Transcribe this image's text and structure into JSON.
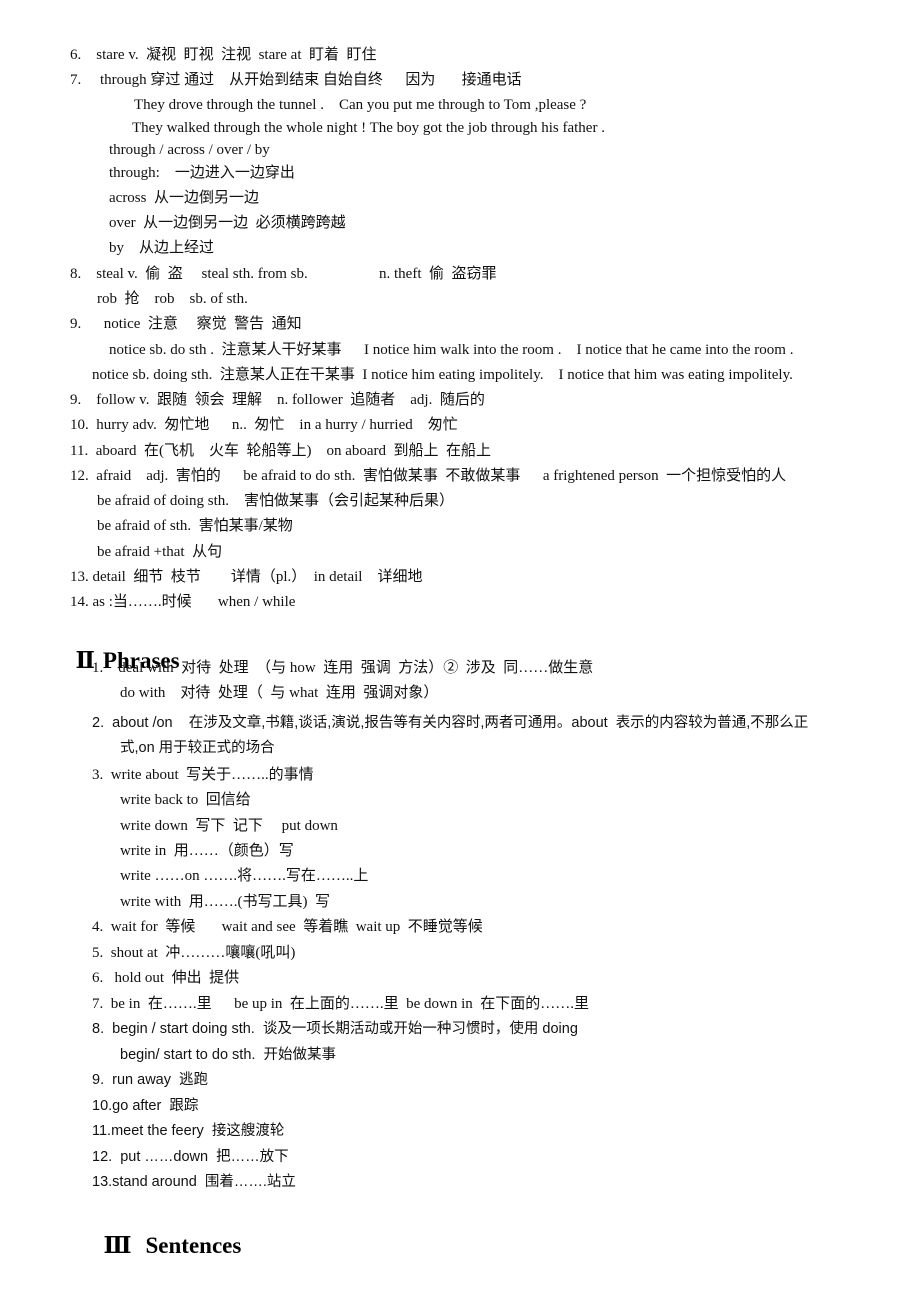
{
  "vocab": [
    {
      "id": "l1",
      "text": "6.    stare v.  凝视  盯视  注视  stare at  盯着  盯住"
    },
    {
      "id": "l2",
      "text": "7.     through 穿过 通过    从开始到结束 自始自终      因为       接通电话"
    },
    {
      "id": "l3",
      "text": "They drove through the tunnel .    Can you put me through to Tom ,please ?"
    },
    {
      "id": "l4",
      "text": "They walked through the whole night ! The boy got the job through his father ."
    },
    {
      "id": "l5",
      "text": "through / across / over / by"
    },
    {
      "id": "l6",
      "text": "through:    一边进入一边穿出"
    },
    {
      "id": "l7",
      "text": "across  从一边倒另一边"
    },
    {
      "id": "l8",
      "text": "over  从一边倒另一边  必须横跨跨越"
    },
    {
      "id": "l9",
      "text": "by    从边上经过"
    },
    {
      "id": "l10",
      "text": "8.    steal v.  偷  盗     steal sth. from sb.                   n. theft  偷  盗窃罪"
    },
    {
      "id": "l11",
      "text": "rob  抢    rob    sb. of sth."
    },
    {
      "id": "l12",
      "text": "9.      notice  注意     察觉  警告  通知"
    },
    {
      "id": "l13",
      "text": "notice sb. do sth .  注意某人干好某事      I notice him walk into the room .    I notice that he came into the room ."
    },
    {
      "id": "l14",
      "text": "notice sb. doing sth.  注意某人正在干某事  I notice him eating impolitely.    I notice that him was eating impolitely."
    },
    {
      "id": "l15",
      "text": "9.    follow v.  跟随  领会  理解    n. follower  追随者    adj.  随后的"
    },
    {
      "id": "l16",
      "text": "10.  hurry adv.  匆忙地      n..  匆忙    in a hurry / hurried    匆忙"
    },
    {
      "id": "l17",
      "text": "11.  aboard  在(飞机    火车  轮船等上)    on aboard  到船上  在船上"
    },
    {
      "id": "l18",
      "text": "12.  afraid    adj.  害怕的      be afraid to do sth.  害怕做某事  不敢做某事      a frightened person  一个担惊受怕的人"
    },
    {
      "id": "l19",
      "text": "be afraid of doing sth.    害怕做某事（会引起某种后果）"
    },
    {
      "id": "l20",
      "text": "be afraid of sth.  害怕某事/某物"
    },
    {
      "id": "l21",
      "text": "be afraid +that  从句"
    },
    {
      "id": "l22",
      "text": "13. detail  细节  枝节        详情（pl.）  in detail    详细地"
    },
    {
      "id": "l23",
      "text": "14. as :当…….时候       when / while"
    }
  ],
  "section2": {
    "numeral": "Ⅱ",
    "title": "Phrases"
  },
  "phrases": [
    {
      "id": "p1",
      "text": "1.    deal with  对待  处理  （与 how  连用  强调  方法）②  涉及  同……做生意"
    },
    {
      "id": "p2",
      "text": "do with    对待  处理（  与 what  连用  强调对象）"
    },
    {
      "id": "p3",
      "text": "2.  about /on    在涉及文章,书籍,谈话,演说,报告等有关内容时,两者可通用。about  表示的内容较为普通,不那么正"
    },
    {
      "id": "p4",
      "text": "式,on 用于较正式的场合"
    },
    {
      "id": "p5",
      "text": "3.  write about  写关于……..的事情"
    },
    {
      "id": "p6",
      "text": "write back to  回信给"
    },
    {
      "id": "p7",
      "text": "write down  写下  记下     put down"
    },
    {
      "id": "p8",
      "text": "write in  用……（颜色）写"
    },
    {
      "id": "p9",
      "text": "write ……on …….将…….写在……..上"
    },
    {
      "id": "p10",
      "text": "write with  用…….(书写工具)  写"
    },
    {
      "id": "p11",
      "text": "4.  wait for  等候       wait and see  等着瞧  wait up  不睡觉等候"
    },
    {
      "id": "p12",
      "text": "5.  shout at  冲………嚷嚷(吼叫)"
    },
    {
      "id": "p13",
      "text": "6.   hold out  伸出  提供"
    },
    {
      "id": "p14",
      "text": "7.  be in  在…….里      be up in  在上面的…….里  be down in  在下面的…….里"
    },
    {
      "id": "p15",
      "text": "8.  begin / start doing sth.  谈及一项长期活动或开始一种习惯时，使用 doing"
    },
    {
      "id": "p16",
      "text": "begin/ start to do sth.  开始做某事"
    },
    {
      "id": "p17",
      "text": "9.  run away  逃跑"
    },
    {
      "id": "p18",
      "text": "10.go after  跟踪"
    },
    {
      "id": "p19",
      "text": "11.meet the feery  接这艘渡轮"
    },
    {
      "id": "p20",
      "text": "12.  put ……down  把……放下"
    },
    {
      "id": "p21",
      "text": "13.stand around  围着…….站立"
    }
  ],
  "section3": {
    "numeral": "Ⅲ",
    "title": "Sentences"
  }
}
